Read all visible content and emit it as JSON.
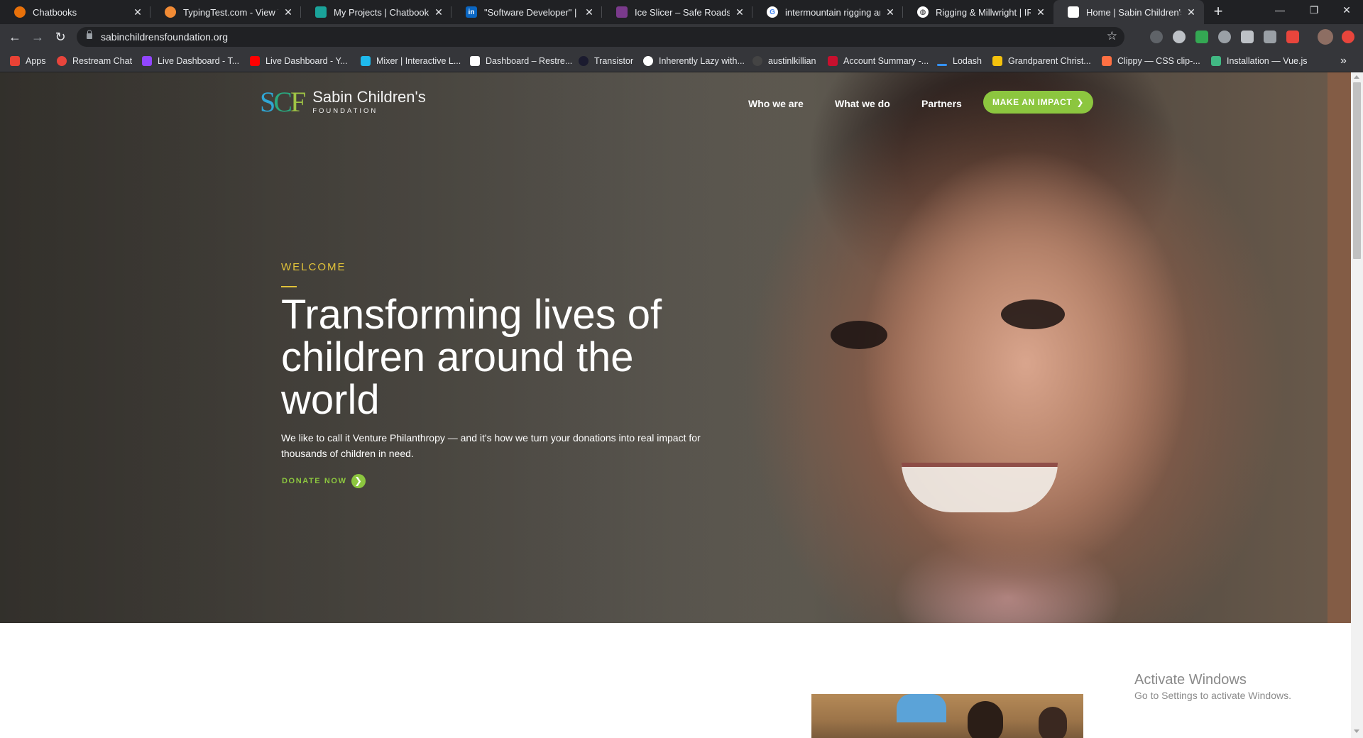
{
  "browser": {
    "tabs": [
      {
        "label": "Chatbooks",
        "favicon": "chatbooks-icon",
        "color": "#e8710a"
      },
      {
        "label": "TypingTest.com - View Your",
        "favicon": "typingtest-icon",
        "color": "#f28b35"
      },
      {
        "label": "My Projects | Chatbooks",
        "favicon": "chatbooks-teal-icon",
        "color": "#1aa39a"
      },
      {
        "label": "\"Software Developer\" | Sear",
        "favicon": "linkedin-icon",
        "color": "#0a66c2"
      },
      {
        "label": "Ice Slicer – Safe Roads. Savi",
        "favicon": "iceslicer-icon",
        "color": "#7a3a8c"
      },
      {
        "label": "intermountain rigging and I",
        "favicon": "google-icon",
        "color": "#ffffff"
      },
      {
        "label": "Rigging & Millwright | IRH",
        "favicon": "globe-icon",
        "color": "#ffffff"
      },
      {
        "label": "Home | Sabin Children's Fou",
        "favicon": "page-icon",
        "color": "#ffffff"
      }
    ],
    "url": "sabinchildrensfoundation.org",
    "bookmarks": [
      {
        "label": "Apps",
        "icon": "apps-grid-icon",
        "color": "#e94235"
      },
      {
        "label": "Restream Chat",
        "icon": "restream-icon",
        "color": "#e8453c"
      },
      {
        "label": "Live Dashboard - T...",
        "icon": "twitch-icon",
        "color": "#9146ff"
      },
      {
        "label": "Live Dashboard - Y...",
        "icon": "youtube-icon",
        "color": "#ff0000"
      },
      {
        "label": "Mixer | Interactive L...",
        "icon": "mixer-icon",
        "color": "#1fbaed"
      },
      {
        "label": "Dashboard – Restre...",
        "icon": "restream-r-icon",
        "color": "#ffffff"
      },
      {
        "label": "Transistor",
        "icon": "transistor-icon",
        "color": "#1b1b2f"
      },
      {
        "label": "Inherently Lazy with...",
        "icon": "globe-icon",
        "color": "#ffffff"
      },
      {
        "label": "austinlkillian",
        "icon": "github-icon",
        "color": "#444444"
      },
      {
        "label": "Account Summary -...",
        "icon": "bank-icon",
        "color": "#c8102e"
      },
      {
        "label": "Lodash",
        "icon": "lodash-icon",
        "color": "#3492ff"
      },
      {
        "label": "Grandparent Christ...",
        "icon": "doc-icon",
        "color": "#f4c20d"
      },
      {
        "label": "Clippy — CSS clip-...",
        "icon": "clippy-icon",
        "color": "#ff7043"
      },
      {
        "label": "Installation — Vue.js",
        "icon": "vue-icon",
        "color": "#41b883"
      }
    ],
    "more_bookmarks": "»"
  },
  "site": {
    "logo_mark": {
      "s": "S",
      "c": "C",
      "f": "F"
    },
    "logo_name": "Sabin Children's",
    "logo_sub": "FOUNDATION",
    "nav": [
      "Who we are",
      "What we do",
      "Partners"
    ],
    "cta": "MAKE AN IMPACT",
    "hero": {
      "eyebrow": "WELCOME",
      "headline": "Transforming lives of children around the world",
      "lede": "We like to call it Venture Philanthropy — and it's how we turn your donations into real impact for thousands of children in need.",
      "donate": "DONATE NOW"
    }
  },
  "os_overlay": {
    "title": "Activate Windows",
    "subtitle": "Go to Settings to activate Windows."
  },
  "colors": {
    "accent_green": "#8cc63f",
    "eyebrow_yellow": "#e1c23a",
    "chrome_dark": "#202124",
    "chrome_toolbar": "#35363a"
  }
}
